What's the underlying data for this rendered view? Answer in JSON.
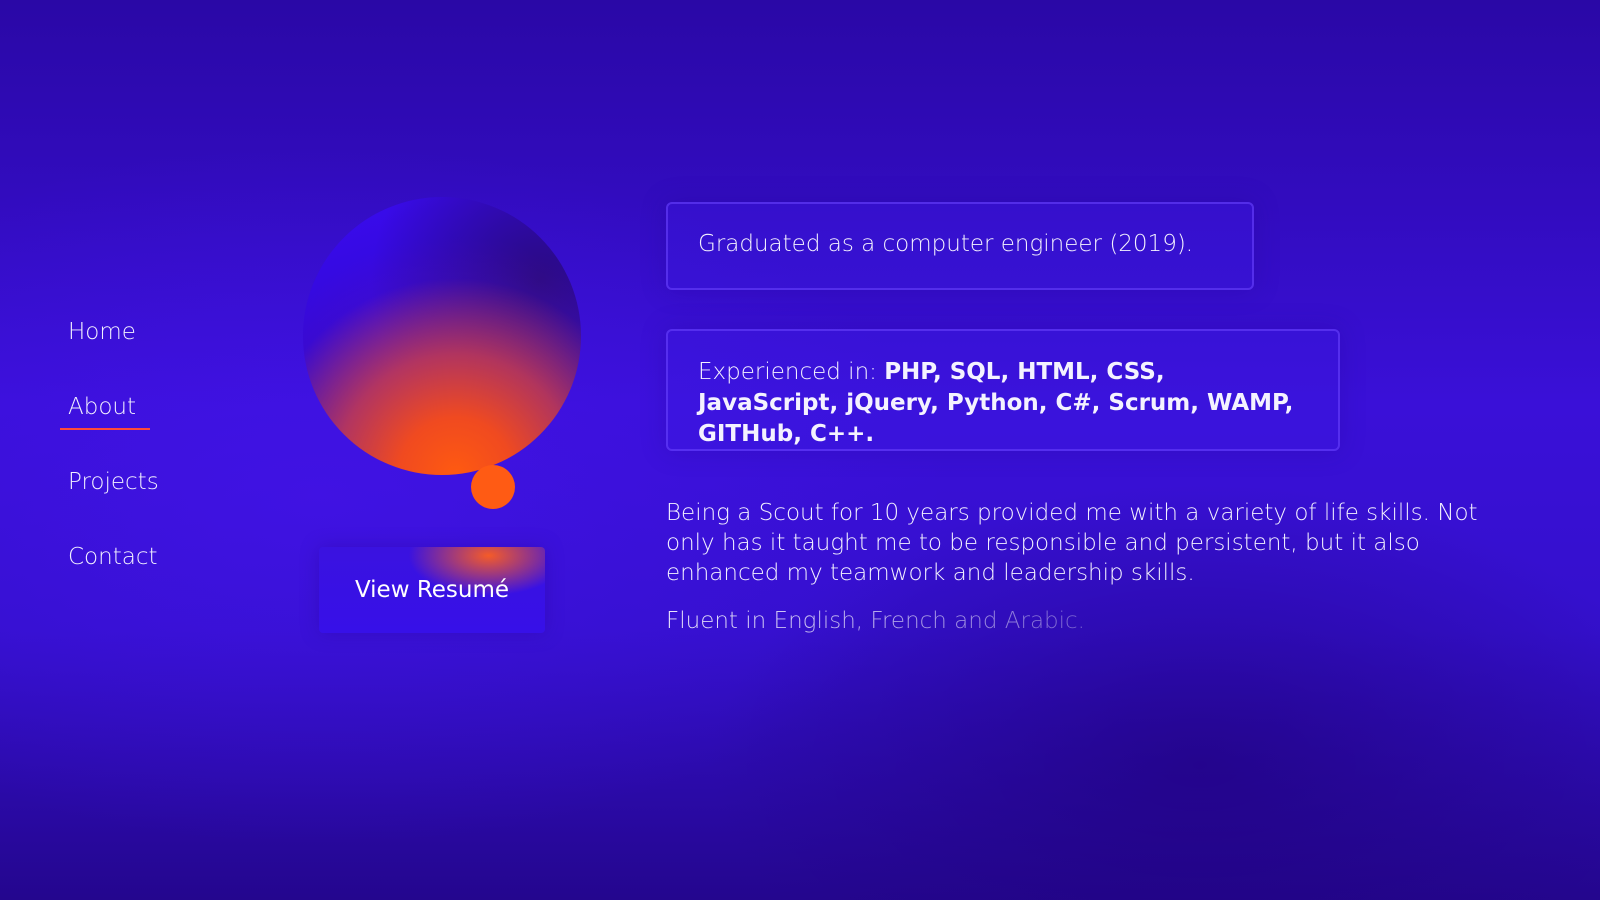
{
  "nav": {
    "items": [
      {
        "label": "Home",
        "active": false
      },
      {
        "label": "About",
        "active": true
      },
      {
        "label": "Projects",
        "active": false
      },
      {
        "label": "Contact",
        "active": false
      }
    ]
  },
  "hero": {
    "button_label": "View Resumé"
  },
  "about": {
    "graduated": "Graduated as a computer engineer (2019).",
    "experience_prefix": "Experienced in: ",
    "experience_skills": "PHP, SQL, HTML, CSS, JavaScript, jQuery, Python, C#, Scrum, WAMP, GITHub, C++.",
    "scout_paragraph": "Being a Scout for 10 years provided me with a variety of life skills. Not only has it taught me to be responsible and persistent, but it also enhanced my teamwork and leadership skills.",
    "languages": "Fluent in English, French and Arabic."
  },
  "colors": {
    "accent": "#ff5b14",
    "underline": "#ff4a3a",
    "background": "#3a10d8"
  }
}
